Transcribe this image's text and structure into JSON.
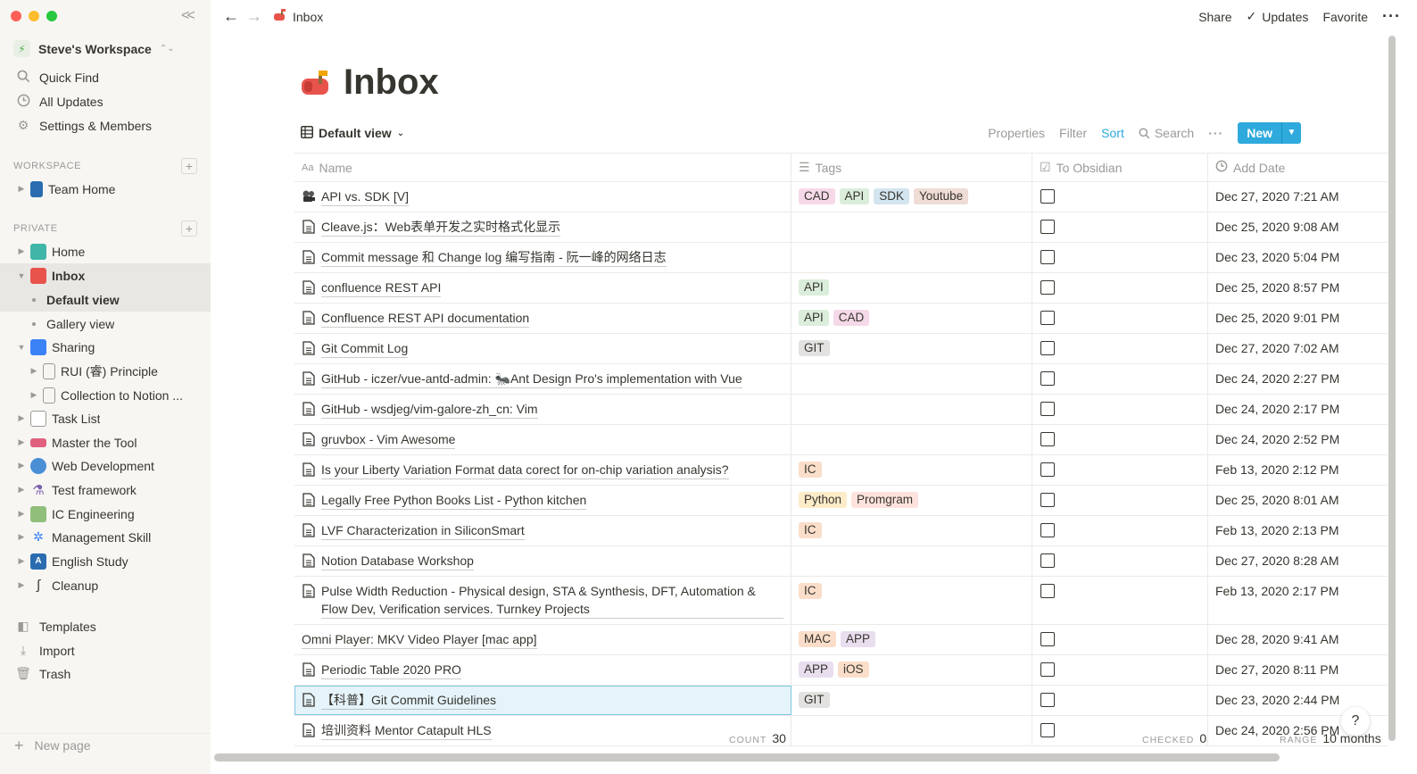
{
  "sidebar": {
    "workspace_name": "Steve's Workspace",
    "top_items": [
      {
        "label": "Quick Find",
        "icon": "search-icon"
      },
      {
        "label": "All Updates",
        "icon": "clock-icon"
      },
      {
        "label": "Settings & Members",
        "icon": "gear-icon"
      }
    ],
    "workspace_section": "WORKSPACE",
    "team_home": "Team Home",
    "private_section": "PRIVATE",
    "tree": [
      {
        "label": "Home"
      },
      {
        "label": "Inbox"
      },
      {
        "label": "Default view"
      },
      {
        "label": "Gallery view"
      },
      {
        "label": "Sharing"
      },
      {
        "label": "RUI (睿) Principle"
      },
      {
        "label": "Collection to Notion ..."
      },
      {
        "label": "Task List"
      },
      {
        "label": "Master the Tool"
      },
      {
        "label": "Web Development"
      },
      {
        "label": "Test framework"
      },
      {
        "label": "IC Engineering"
      },
      {
        "label": "Management Skill"
      },
      {
        "label": "English Study"
      },
      {
        "label": "Cleanup"
      }
    ],
    "bottom_items": [
      {
        "label": "Templates",
        "icon": "templates-icon"
      },
      {
        "label": "Import",
        "icon": "import-icon"
      },
      {
        "label": "Trash",
        "icon": "trash-icon"
      }
    ],
    "new_page": "New page"
  },
  "topbar": {
    "breadcrumb": "Inbox",
    "share": "Share",
    "updates": "Updates",
    "favorite": "Favorite"
  },
  "page": {
    "title": "Inbox",
    "view_name": "Default view",
    "actions": {
      "properties": "Properties",
      "filter": "Filter",
      "sort": "Sort",
      "search": "Search",
      "new": "New"
    }
  },
  "table": {
    "columns": [
      "Name",
      "Tags",
      "To Obsidian",
      "Add Date"
    ],
    "rows": [
      {
        "name": "API vs. SDK [V]",
        "tags": [
          "CAD",
          "API",
          "SDK",
          "Youtube"
        ],
        "date": "Dec 27, 2020 7:21 AM",
        "icon": "projector"
      },
      {
        "name": "Cleave.js：Web表单开发之实时格式化显示",
        "tags": [],
        "date": "Dec 25, 2020 9:08 AM",
        "icon": "page"
      },
      {
        "name": "Commit message 和 Change log 编写指南 - 阮一峰的网络日志",
        "tags": [],
        "date": "Dec 23, 2020 5:04 PM",
        "icon": "page"
      },
      {
        "name": "confluence REST API",
        "tags": [
          "API"
        ],
        "date": "Dec 25, 2020 8:57 PM",
        "icon": "page"
      },
      {
        "name": "Confluence REST API documentation",
        "tags": [
          "API",
          "CAD"
        ],
        "date": "Dec 25, 2020 9:01 PM",
        "icon": "page"
      },
      {
        "name": "Git Commit Log",
        "tags": [
          "GIT"
        ],
        "date": "Dec 27, 2020 7:02 AM",
        "icon": "page"
      },
      {
        "name": "GitHub - iczer/vue-antd-admin: 🐜Ant Design Pro's implementation with Vue",
        "tags": [],
        "date": "Dec 24, 2020 2:27 PM",
        "icon": "page"
      },
      {
        "name": "GitHub - wsdjeg/vim-galore-zh_cn: Vim",
        "tags": [],
        "date": "Dec 24, 2020 2:17 PM",
        "icon": "page"
      },
      {
        "name": "gruvbox - Vim Awesome",
        "tags": [],
        "date": "Dec 24, 2020 2:52 PM",
        "icon": "page"
      },
      {
        "name": "Is your Liberty Variation Format data corect for on-chip variation analysis?",
        "tags": [
          "IC"
        ],
        "date": "Feb 13, 2020 2:12 PM",
        "icon": "page"
      },
      {
        "name": "Legally Free Python Books List - Python kitchen",
        "tags": [
          "Python",
          "Promgram"
        ],
        "date": "Dec 25, 2020 8:01 AM",
        "icon": "page"
      },
      {
        "name": "LVF Characterization in SiliconSmart",
        "tags": [
          "IC"
        ],
        "date": "Feb 13, 2020 2:13 PM",
        "icon": "page"
      },
      {
        "name": "Notion Database Workshop",
        "tags": [],
        "date": "Dec 27, 2020 8:28 AM",
        "icon": "page"
      },
      {
        "name": "Pulse Width Reduction - Physical design, STA & Synthesis, DFT, Automation & Flow Dev, Verification services. Turnkey Projects",
        "tags": [
          "IC"
        ],
        "date": "Feb 13, 2020 2:17 PM",
        "icon": "page"
      },
      {
        "name": "Omni Player: MKV Video Player [mac app]",
        "tags": [
          "MAC",
          "APP"
        ],
        "date": "Dec 28, 2020 9:41 AM",
        "icon": "none"
      },
      {
        "name": "Periodic Table 2020 PRO",
        "tags": [
          "APP",
          "iOS"
        ],
        "date": "Dec 27, 2020 8:11 PM",
        "icon": "page"
      },
      {
        "name": "【科普】Git Commit Guidelines",
        "tags": [
          "GIT"
        ],
        "date": "Dec 23, 2020 2:44 PM",
        "icon": "page"
      },
      {
        "name": "培训资料 Mentor Catapult HLS",
        "tags": [],
        "date": "Dec 24, 2020 2:56 PM",
        "icon": "page"
      }
    ]
  },
  "tag_colors": {
    "CAD": "#f5d9e8",
    "API": "#dbeddb",
    "SDK": "#d3e5ef",
    "Youtube": "#eedcd5",
    "GIT": "#e3e2e0",
    "IC": "#fadec9",
    "Python": "#fdecc8",
    "Promgram": "#ffe2dd",
    "MAC": "#fadec9",
    "APP": "#e8deee",
    "iOS": "#fadec9"
  },
  "footer": {
    "count_label": "COUNT",
    "count_value": "30",
    "checked_label": "CHECKED",
    "checked_value": "0",
    "range_label": "RANGE",
    "range_value": "10 months"
  }
}
